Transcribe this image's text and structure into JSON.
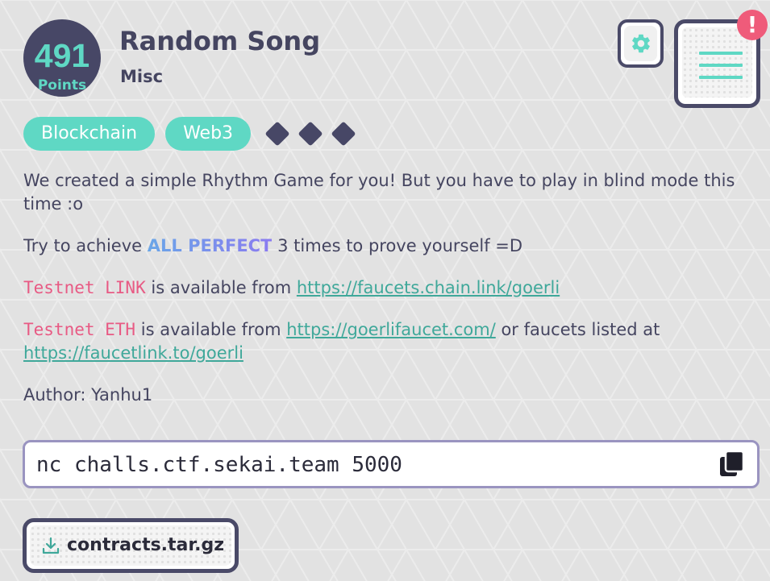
{
  "challenge": {
    "points_value": "491",
    "points_label": "Points",
    "title": "Random Song",
    "category": "Misc"
  },
  "tags": [
    "Blockchain",
    "Web3"
  ],
  "difficulty": {
    "filled": 3,
    "total": 3
  },
  "description": {
    "p1": "We created a simple Rhythm Game for you! But you have to play in blind mode this time :o",
    "p2_prefix": "Try to achieve ",
    "p2_highlight": "ALL PERFECT",
    "p2_suffix": " 3 times to prove yourself =D",
    "p3_code": "Testnet LINK",
    "p3_middle": " is available from ",
    "p3_link": "https://faucets.chain.link/goerli",
    "p4_code": "Testnet ETH",
    "p4_middle": " is available from ",
    "p4_link1": "https://goerlifaucet.com/",
    "p4_between": " or faucets listed at ",
    "p4_link2": "https://faucetlink.to/goerli",
    "author": "Author: Yanhu1"
  },
  "command": {
    "text": "nc challs.ctf.sekai.team 5000",
    "copy_icon": "copy-icon"
  },
  "attachment": {
    "filename": "contracts.tar.gz",
    "icon": "download-icon"
  },
  "notification": {
    "badge_text": "!"
  },
  "icons": {
    "settings": "gear-icon",
    "menu": "hamburger-menu-icon"
  },
  "colors": {
    "accent_teal": "#5fd8c4",
    "dark_navy": "#474766",
    "alert_pink": "#ef5b7a",
    "code_pink": "#e85a84",
    "link_teal": "#3fa89a"
  }
}
